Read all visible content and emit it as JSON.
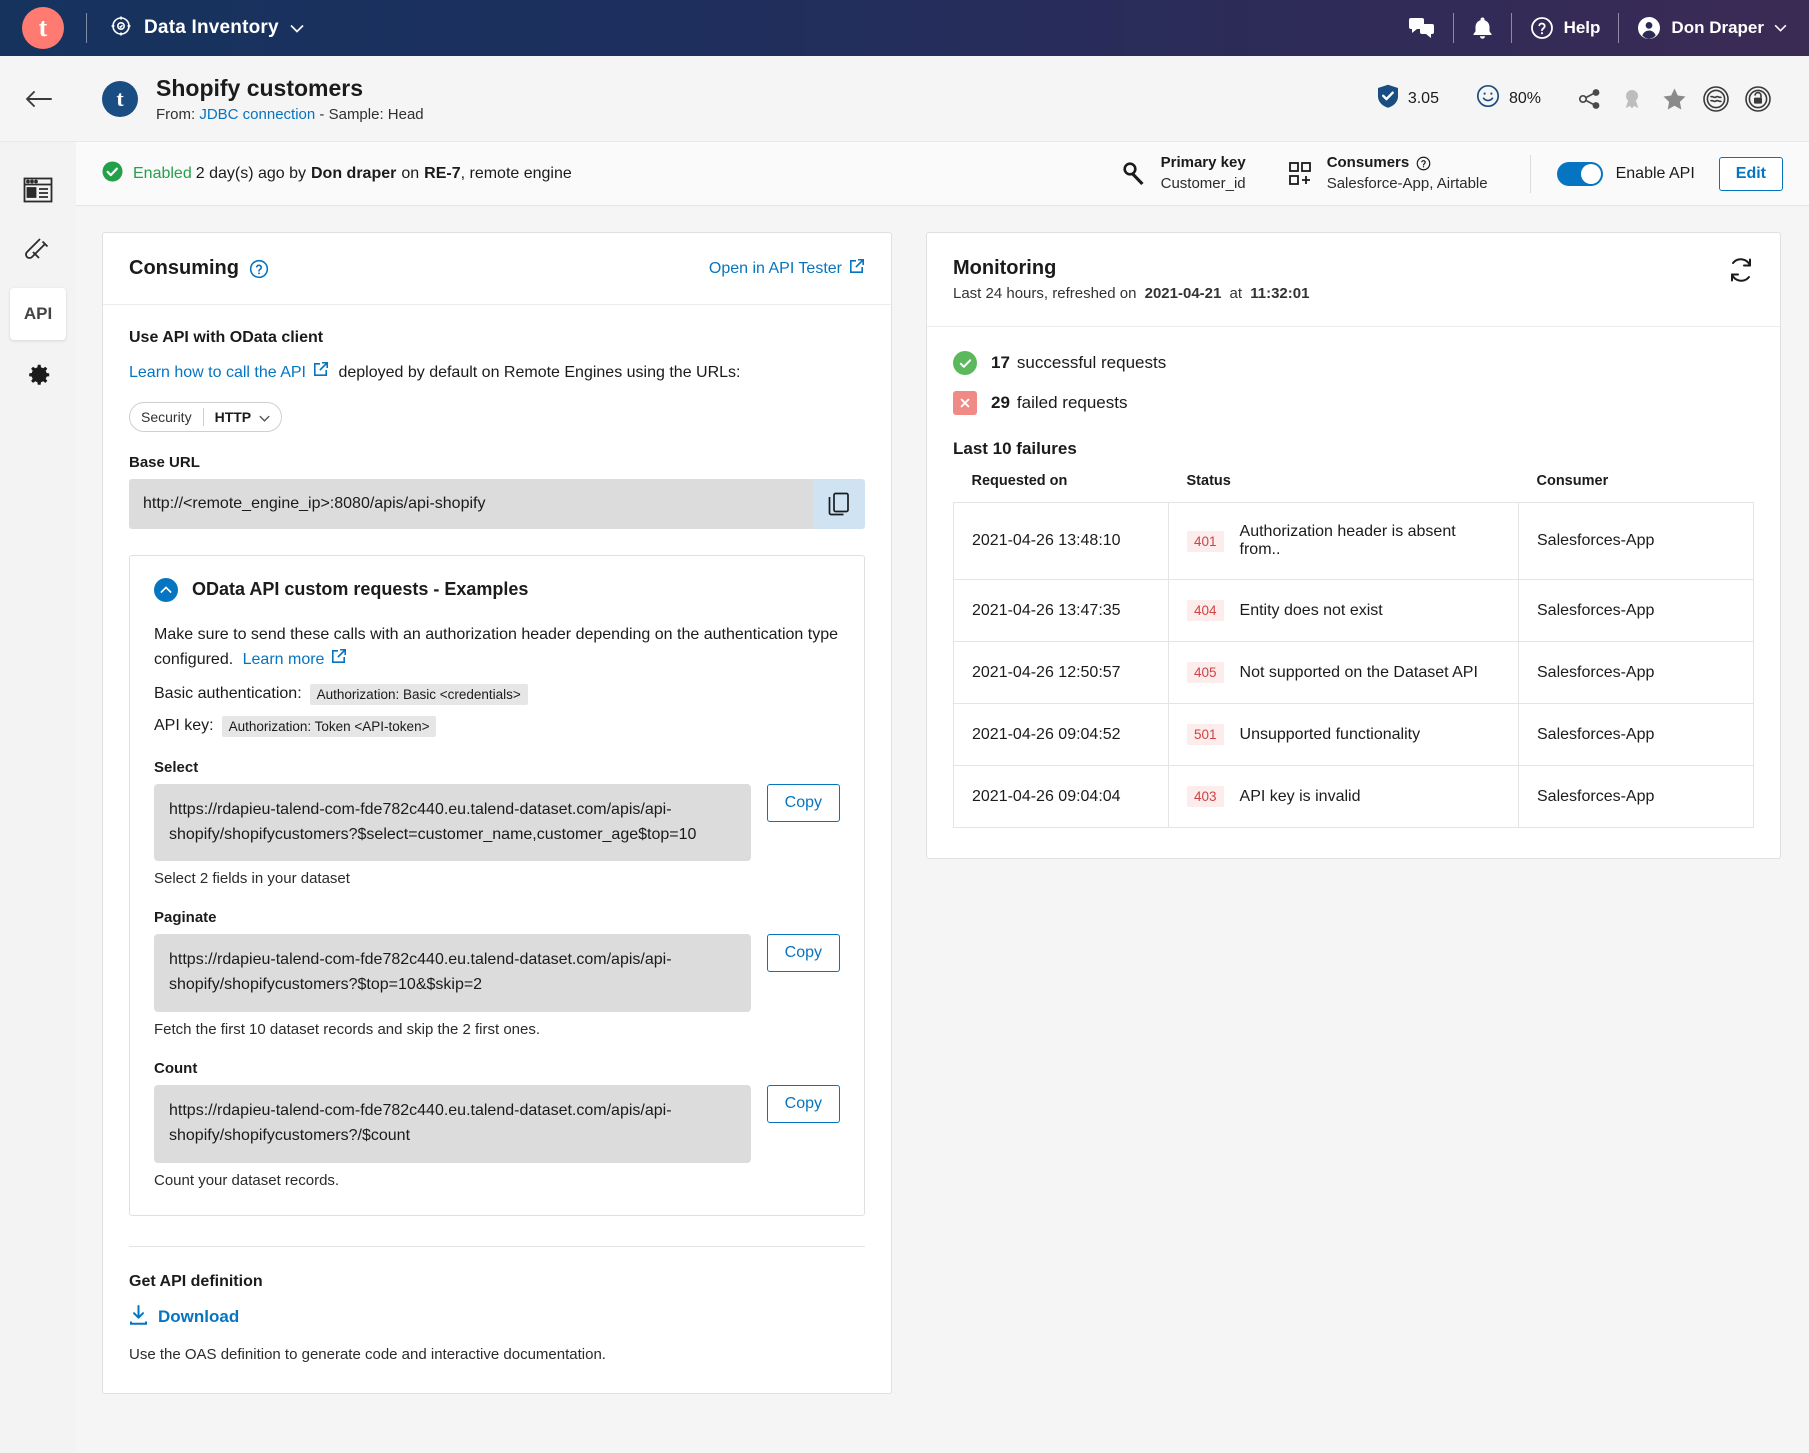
{
  "topnav": {
    "logo_letter": "t",
    "app_name": "Data Inventory",
    "chevron": "⌄",
    "help_label": "Help",
    "user_name": "Don Draper",
    "icons": [
      "chat-icon",
      "bell-icon",
      "help-icon",
      "user-avatar-icon"
    ]
  },
  "pagehead": {
    "avatar_letter": "t",
    "title": "Shopify customers",
    "from_label": "From:",
    "connection": "JDBC connection",
    "separator": "-",
    "sample": "Sample: Head",
    "trust_score": "3.05",
    "popularity": "80%",
    "icons": [
      "shield-check-icon",
      "smiley-icon",
      "share-icon",
      "certify-icon",
      "star-icon",
      "lineage-icon",
      "lock-icon"
    ]
  },
  "statusbar": {
    "state": "Enabled",
    "when": "2 day(s) ago by",
    "author": "Don draper",
    "on": "on",
    "engine": "RE-7",
    "engine_suffix": ", remote engine",
    "primary_key_label": "Primary key",
    "primary_key_value": "Customer_id",
    "consumers_label": "Consumers",
    "consumers_value": "Salesforce-App, Airtable",
    "enable_api_label": "Enable API",
    "edit_label": "Edit"
  },
  "rail": {
    "items": [
      {
        "name": "overview",
        "label": ""
      },
      {
        "name": "sample",
        "label": ""
      },
      {
        "name": "api",
        "label": "API"
      },
      {
        "name": "settings",
        "label": ""
      }
    ]
  },
  "consuming": {
    "title": "Consuming",
    "open_tester": "Open in API Tester",
    "section_title": "Use API with OData client",
    "learn_link": "Learn how to call the API",
    "learn_rest": "deployed by default on Remote Engines using the URLs:",
    "security_label": "Security",
    "security_value": "HTTP",
    "base_url_label": "Base URL",
    "base_url_value": "http://<remote_engine_ip>:8080/apis/api-shopify",
    "examples_title": "OData API custom requests - Examples",
    "examples_para": "Make sure to send these calls with an authorization header depending on the authentication type configured.",
    "examples_learn_more": "Learn more",
    "basic_auth_label": "Basic authentication:",
    "basic_auth_value": "Authorization: Basic <credentials>",
    "api_key_label": "API key:",
    "api_key_value": "Authorization: Token <API-token>",
    "copy_label": "Copy",
    "snippets": [
      {
        "label": "Select",
        "url": "https://rdapieu-talend-com-fde782c440.eu.talend-dataset.com/apis/api-shopify/shopifycustomers?$select=customer_name,customer_age$top=10",
        "hint": "Select 2 fields in your dataset"
      },
      {
        "label": "Paginate",
        "url": "https://rdapieu-talend-com-fde782c440.eu.talend-dataset.com/apis/api-shopify/shopifycustomers?$top=10&$skip=2",
        "hint": "Fetch the first 10 dataset records and skip the 2 first ones."
      },
      {
        "label": "Count",
        "url": "https://rdapieu-talend-com-fde782c440.eu.talend-dataset.com/apis/api-shopify/shopifycustomers?/$count",
        "hint": "Count your dataset records."
      }
    ],
    "definition_title": "Get API definition",
    "download_label": "Download",
    "definition_hint": "Use the OAS definition to generate code and interactive documentation."
  },
  "monitoring": {
    "title": "Monitoring",
    "subtitle_prefix": "Last 24 hours, refreshed on",
    "refreshed_date": "2021-04-21",
    "refreshed_at_word": "at",
    "refreshed_time": "11:32:01",
    "success_count": "17",
    "success_label": "successful requests",
    "failed_count": "29",
    "failed_label": "failed requests",
    "failures_title": "Last 10 failures",
    "columns": [
      "Requested on",
      "Status",
      "Consumer"
    ],
    "rows": [
      {
        "requested_on": "2021-04-26 13:48:10",
        "code": "401",
        "message": "Authorization header is absent from..",
        "consumer": "Salesforces-App"
      },
      {
        "requested_on": "2021-04-26 13:47:35",
        "code": "404",
        "message": "Entity does not exist",
        "consumer": "Salesforces-App"
      },
      {
        "requested_on": "2021-04-26 12:50:57",
        "code": "405",
        "message": "Not supported on the Dataset API",
        "consumer": "Salesforces-App"
      },
      {
        "requested_on": "2021-04-26 09:04:52",
        "code": "501",
        "message": "Unsupported functionality",
        "consumer": "Salesforces-App"
      },
      {
        "requested_on": "2021-04-26 09:04:04",
        "code": "403",
        "message": "API key is invalid",
        "consumer": "Salesforces-App"
      }
    ]
  },
  "colors": {
    "brand_coral": "#ff7a70",
    "nav_start": "#16335e",
    "nav_end": "#3b2b55",
    "link_blue": "#0675c1",
    "success_green": "#24a04a",
    "error_red": "#c44"
  }
}
